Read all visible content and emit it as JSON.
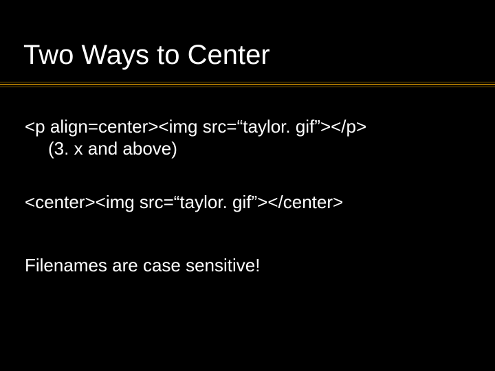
{
  "slide": {
    "title": "Two Ways to Center",
    "lines": {
      "l1": "<p align=center><img src=“taylor. gif”></p>",
      "l2": "(3. x and above)",
      "l3": "<center><img src=“taylor. gif”></center>",
      "l4": "Filenames are case sensitive!"
    }
  }
}
